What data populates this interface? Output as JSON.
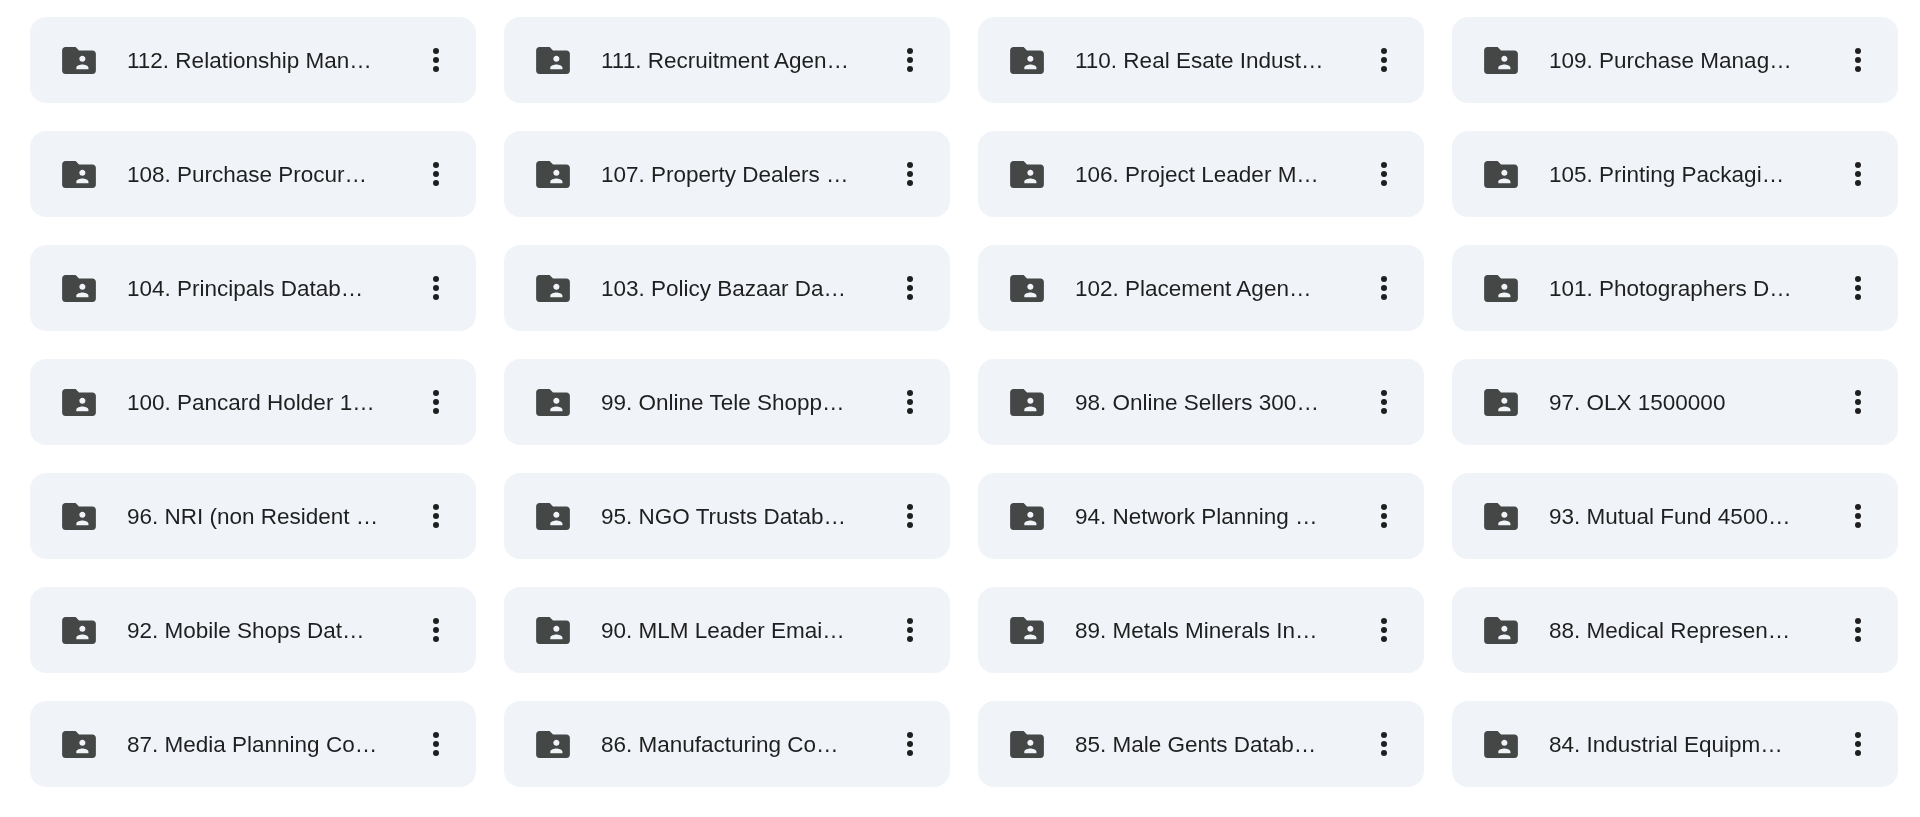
{
  "folders": [
    {
      "name": "112. Relationship Man…"
    },
    {
      "name": "111. Recruitment Agen…"
    },
    {
      "name": "110. Real Esate Indust…"
    },
    {
      "name": "109. Purchase Manag…"
    },
    {
      "name": "108. Purchase Procur…"
    },
    {
      "name": "107. Property Dealers …"
    },
    {
      "name": "106. Project Leader M…"
    },
    {
      "name": "105. Printing Packagi…"
    },
    {
      "name": "104. Principals Datab…"
    },
    {
      "name": "103. Policy Bazaar Da…"
    },
    {
      "name": "102. Placement Agen…"
    },
    {
      "name": "101. Photographers D…"
    },
    {
      "name": "100. Pancard Holder 1…"
    },
    {
      "name": "99. Online Tele Shopp…"
    },
    {
      "name": "98. Online Sellers 300…"
    },
    {
      "name": "97. OLX 1500000"
    },
    {
      "name": "96. NRI (non Resident …"
    },
    {
      "name": "95. NGO Trusts Datab…"
    },
    {
      "name": "94. Network Planning …"
    },
    {
      "name": "93. Mutual Fund 4500…"
    },
    {
      "name": "92. Mobile Shops Dat…"
    },
    {
      "name": "90. MLM Leader Emai…"
    },
    {
      "name": "89. Metals Minerals In…"
    },
    {
      "name": "88. Medical Represen…"
    },
    {
      "name": "87. Media Planning Co…"
    },
    {
      "name": "86. Manufacturing Co…"
    },
    {
      "name": "85. Male Gents Datab…"
    },
    {
      "name": "84. Industrial Equipm…"
    }
  ]
}
